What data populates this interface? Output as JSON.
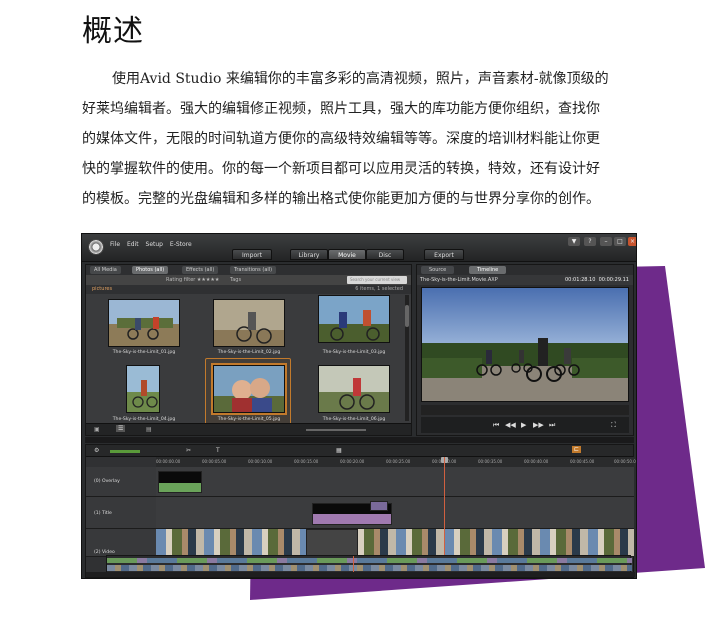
{
  "heading": "概述",
  "paragraph": {
    "lines": [
      "使用Avid Studio 来编辑你的丰富多彩的高清视频，照片，声音素材-就像顶级的",
      "好莱坞编辑者。强大的编辑修正视频，照片工具，强大的库功能方便你组织，查找你",
      "的媒体文件，无限的时间轨道方便你的高级特效编辑等等。深度的培训材料能让你更",
      "快的掌握软件的使用。你的每一个新项目都可以应用灵活的转换，特效，还有设计好",
      "的模板。完整的光盘编辑和多样的输出格式使你能更加方便的与世界分享你的创作。"
    ]
  },
  "colors": {
    "purple_accent": "#6e2a8a",
    "selection_orange": "#c27a2c"
  },
  "app": {
    "menu": [
      "File",
      "Edit",
      "Setup",
      "E-Store"
    ],
    "top_tabs": {
      "import": "Import",
      "library": "Library",
      "movie": "Movie",
      "disc": "Disc",
      "export": "Export"
    },
    "library": {
      "filter_tabs": [
        "All Media",
        "Photos (all)",
        "Effects (all)",
        "Transitions (all)"
      ],
      "rating_filter": "Rating filter ★★★★★",
      "tags_label": "Tags",
      "search_placeholder": "Search your current view",
      "folder": "pictures",
      "count": "6 items, 1 selected",
      "items": [
        {
          "caption": "The-Sky-is-the-Limit_01.jpg"
        },
        {
          "caption": "The-Sky-is-the-Limit_02.jpg"
        },
        {
          "caption": "The-Sky-is-the-Limit_03.jpg"
        },
        {
          "caption": "The-Sky-is-the-Limit_04.jpg"
        },
        {
          "caption": "The-Sky-is-the-Limit_05.jpg"
        },
        {
          "caption": "The-Sky-is-the-Limit_06.jpg"
        }
      ]
    },
    "player": {
      "tab_source": "Source",
      "tab_timeline": "Timeline",
      "movie_name": "The-Sky-is-the-Limit.Movie.AXP",
      "timecode_in": "00:01:28.10",
      "timecode_total": "00:00:29.11"
    },
    "timeline": {
      "tracks": [
        {
          "name": "(0) Overlay"
        },
        {
          "name": "(1) Title"
        },
        {
          "name": "(2) Video"
        }
      ],
      "ruler": [
        "00:00:00.00",
        "00:00:05.00",
        "00:00:10.00",
        "00:00:15.00",
        "00:00:20.00",
        "00:00:25.00",
        "00:00:30.00",
        "00:00:35.00",
        "00:00:40.00",
        "00:00:45.00",
        "00:00:50.00"
      ]
    }
  }
}
